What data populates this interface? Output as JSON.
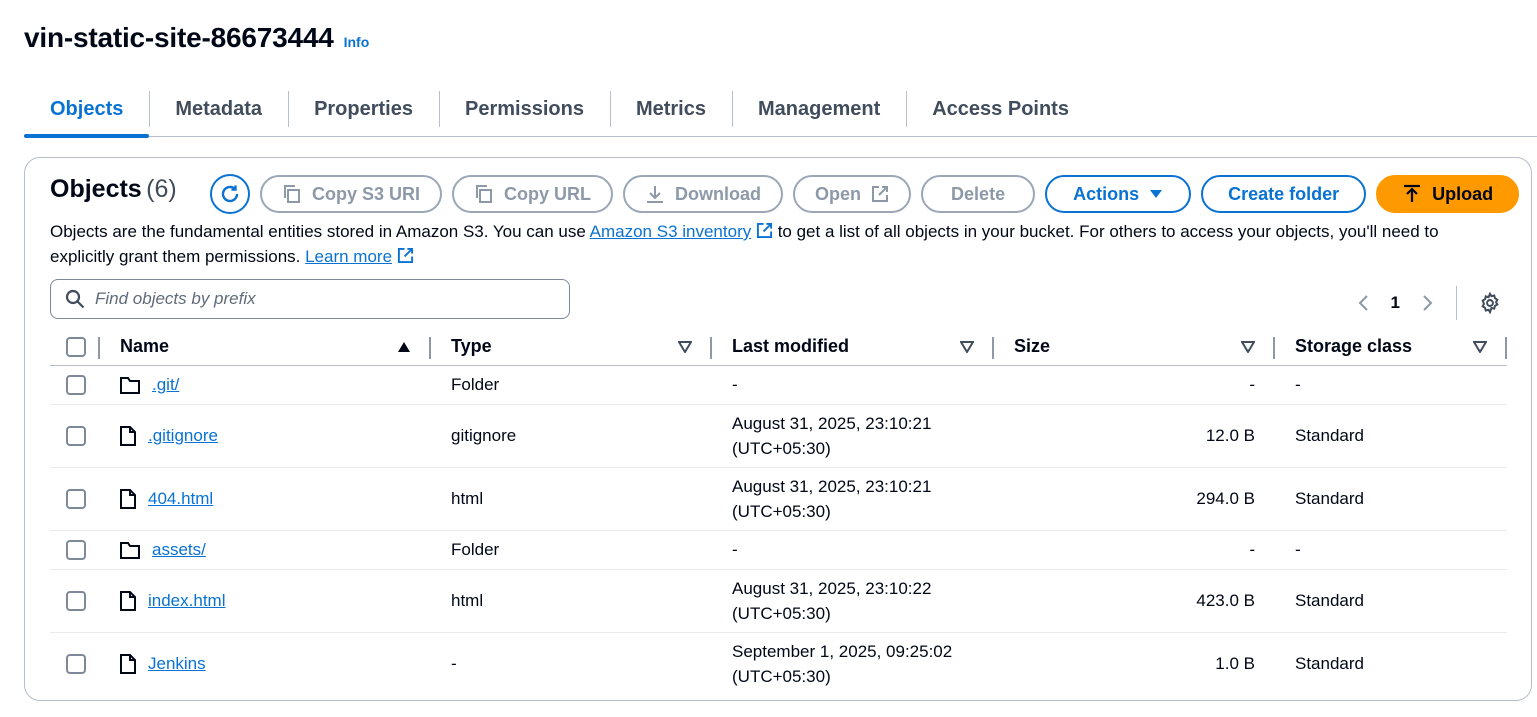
{
  "header": {
    "bucket_name": "vin-static-site-86673444",
    "info_label": "Info"
  },
  "tabs": [
    {
      "label": "Objects",
      "active": true
    },
    {
      "label": "Metadata"
    },
    {
      "label": "Properties"
    },
    {
      "label": "Permissions"
    },
    {
      "label": "Metrics"
    },
    {
      "label": "Management"
    },
    {
      "label": "Access Points"
    }
  ],
  "objects_panel": {
    "title": "Objects",
    "count": "(6)",
    "toolbar": {
      "copy_s3_uri": "Copy S3 URI",
      "copy_url": "Copy URL",
      "download": "Download",
      "open": "Open",
      "delete": "Delete",
      "actions": "Actions",
      "create_folder": "Create folder",
      "upload": "Upload"
    },
    "description": {
      "part1": "Objects are the fundamental entities stored in Amazon S3. You can use ",
      "inventory_link": "Amazon S3 inventory",
      "part2": " to get a list of all objects in your bucket. For others to access your objects, you'll need to explicitly grant them permissions. ",
      "learn_more": "Learn more"
    },
    "search": {
      "placeholder": "Find objects by prefix",
      "value": ""
    },
    "pagination": {
      "page": "1"
    },
    "columns": {
      "name": "Name",
      "type": "Type",
      "last_modified": "Last modified",
      "size": "Size",
      "storage_class": "Storage class"
    },
    "rows": [
      {
        "icon": "folder-icon",
        "name": ".git/",
        "type": "Folder",
        "modified_1": "-",
        "modified_2": "",
        "size": "-",
        "storage": "-"
      },
      {
        "icon": "file-icon",
        "name": ".gitignore",
        "type": "gitignore",
        "modified_1": "August 31, 2025, 23:10:21",
        "modified_2": "(UTC+05:30)",
        "size": "12.0 B",
        "storage": "Standard"
      },
      {
        "icon": "file-icon",
        "name": "404.html",
        "type": "html",
        "modified_1": "August 31, 2025, 23:10:21",
        "modified_2": "(UTC+05:30)",
        "size": "294.0 B",
        "storage": "Standard"
      },
      {
        "icon": "folder-icon",
        "name": "assets/",
        "type": "Folder",
        "modified_1": "-",
        "modified_2": "",
        "size": "-",
        "storage": "-"
      },
      {
        "icon": "file-icon",
        "name": "index.html",
        "type": "html",
        "modified_1": "August 31, 2025, 23:10:22",
        "modified_2": "(UTC+05:30)",
        "size": "423.0 B",
        "storage": "Standard"
      },
      {
        "icon": "file-icon",
        "name": "Jenkins",
        "type": "-",
        "modified_1": "September 1, 2025, 09:25:02",
        "modified_2": "(UTC+05:30)",
        "size": "1.0 B",
        "storage": "Standard"
      }
    ]
  },
  "colors": {
    "accent": "#0972d3",
    "upload": "#ff9900",
    "disabled": "#8d99a8"
  }
}
